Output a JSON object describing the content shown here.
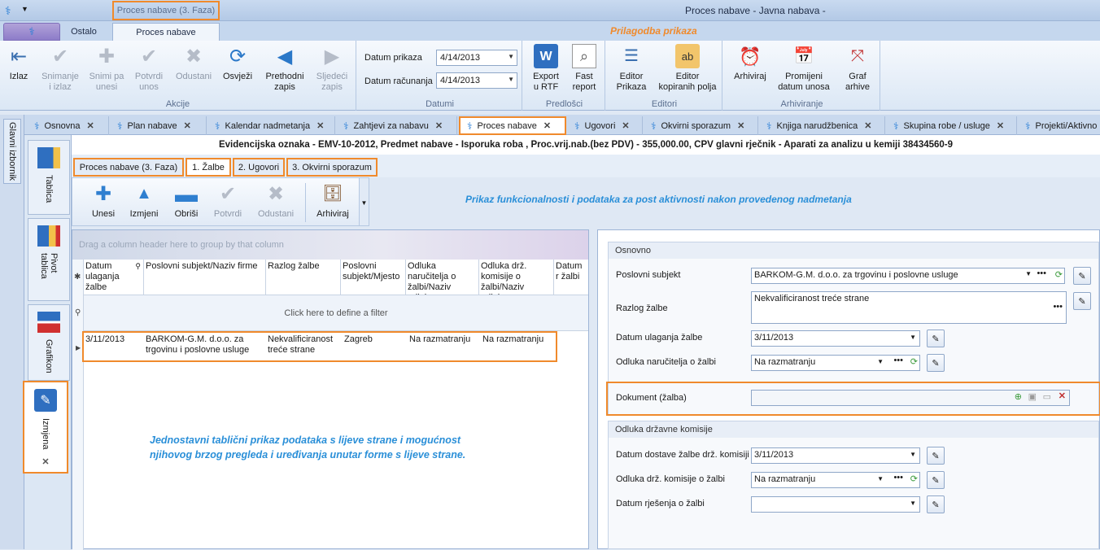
{
  "titlebar": {
    "qat_title": "Proces nabave (3. Faza)",
    "window_title": "Proces nabave - Javna nabava -"
  },
  "ribbon_tabs": {
    "app": "",
    "ostalo": "Ostalo",
    "proces": "Proces nabave"
  },
  "annotation_top": "Prilagodba prikaza",
  "ribbon": {
    "akcije": {
      "label": "Akcije",
      "izlaz": "Izlaz",
      "snimanje": "Snimanje i izlaz",
      "snimi": "Snimi pa unesi",
      "potvrdi": "Potvrdi unos",
      "odustani": "Odustani",
      "osvjezi": "Osvježi",
      "prethodni": "Prethodni zapis",
      "sljedeci": "Sljedeći zapis"
    },
    "datumi": {
      "label": "Datumi",
      "prikaza_label": "Datum prikaza",
      "prikaza_value": "4/14/2013",
      "racunanja_label": "Datum računanja",
      "racunanja_value": "4/14/2013"
    },
    "predlosci": {
      "label": "Predlošci",
      "export": "Export u RTF",
      "fast": "Fast report"
    },
    "editori": {
      "label": "Editori",
      "editor_prikaza": "Editor Prikaza",
      "editor_kopiranih": "Editor kopiranih polja"
    },
    "arhiviranje": {
      "label": "Arhiviranje",
      "arhiviraj": "Arhiviraj",
      "promijeni": "Promijeni datum unosa",
      "graf": "Graf arhive"
    }
  },
  "side_rail": {
    "glavni": "Glavni izbornik"
  },
  "mdi_tabs": [
    "Osnovna",
    "Plan nabave",
    "Kalendar nadmetanja",
    "Zahtjevi za nabavu",
    "Proces nabave",
    "Ugovori",
    "Okvirni sporazum",
    "Knjiga narudžbenica",
    "Skupina robe / usluge",
    "Projekti/Aktivno"
  ],
  "sidebar": {
    "tablica": "Tablica",
    "pivot": "Pivot tablica",
    "grafikon": "Grafikon",
    "izmjena": "Izmjena"
  },
  "record_header": "Evidencijska oznaka - EMV-10-2012, Predmet nabave - Isporuka roba , Proc.vrij.nab.(bez PDV) - 355,000.00, CPV glavni rječnik - Aparati za analizu u kemiji 38434560-9",
  "sub_tabs": {
    "proces": "Proces nabave (3. Faza)",
    "zalbe": "1. Žalbe",
    "ugovori": "2. Ugovori",
    "okvirni": "3. Okvirni sporazum"
  },
  "grid_toolbar": {
    "unesi": "Unesi",
    "izmjeni": "Izmjeni",
    "obrisi": "Obriši",
    "potvrdi": "Potvrdi",
    "odustani": "Odustani",
    "arhiviraj": "Arhiviraj"
  },
  "annotation_middle": "Prikaz funkcionalnosti i podataka za post aktivnosti nakon provedenog nadmetanja",
  "grid": {
    "group_hint": "Drag a column header here to group by that column",
    "filter_hint": "Click here to define a filter",
    "columns": [
      "Datum ulaganja žalbe",
      "Poslovni subjekt/Naziv firme",
      "Razlog žalbe",
      "Poslovni subjekt/Mjesto",
      "Odluka naručitelja o žalbi/Naziv odluke",
      "Odluka drž. komisije o žalbi/Naziv odluke",
      "Datum r žalbi"
    ],
    "row": [
      "3/11/2013",
      "BARKOM-G.M. d.o.o. za trgovinu i poslovne usluge",
      "Nekvalificiranost treće strane",
      "Zagreb",
      "Na razmatranju",
      "Na razmatranju"
    ]
  },
  "annotation_bottom": {
    "line1": "Jednostavni tablični prikaz podataka s lijeve strane i mogućnost",
    "line2": "njihovog brzog pregleda i uređivanja unutar forme s lijeve strane."
  },
  "form": {
    "osnovno_title": "Osnovno",
    "poslovni_label": "Poslovni subjekt",
    "poslovni_value": "BARKOM-G.M. d.o.o. za trgovinu i poslovne usluge",
    "razlog_label": "Razlog žalbe",
    "razlog_value": "Nekvalificiranost treće strane",
    "datum_ul_label": "Datum ulaganja žalbe",
    "datum_ul_value": "3/11/2013",
    "odluka_nar_label": "Odluka naručitelja o žalbi",
    "odluka_nar_value": "Na razmatranju",
    "dokument_label": "Dokument (žalba)",
    "dokument_value": "",
    "komisija_title": "Odluka državne komisije",
    "dostava_label": "Datum dostave žalbe drž. komisiji",
    "dostava_value": "3/11/2013",
    "odluka_kom_label": "Odluka drž. komisije o žalbi",
    "odluka_kom_value": "Na razmatranju",
    "rjesenje_label": "Datum rješenja o žalbi",
    "rjesenje_value": ""
  },
  "colors": {
    "accent_orange": "#f08a2c",
    "annotation_blue": "#2a8fd8",
    "ribbon_blue": "#dbe7f5"
  }
}
